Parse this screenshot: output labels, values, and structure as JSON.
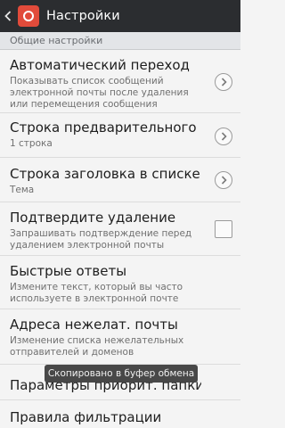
{
  "action_bar": {
    "title": "Настройки",
    "app_icon": "mail-app-icon",
    "back_icon": "chevron-left-icon"
  },
  "section": {
    "label": "Общие настройки"
  },
  "items": [
    {
      "title": "Автоматический переход",
      "summary": "Показывать список сообщений электронной почты после удаления или перемещения сообщения",
      "control": "chevron"
    },
    {
      "title": "Строка предварительного п...",
      "summary": "1 строка",
      "control": "chevron"
    },
    {
      "title": "Строка заголовка в списке",
      "summary": "Тема",
      "control": "chevron"
    },
    {
      "title": "Подтвердите удаление",
      "summary": "Запрашивать подтверждение перед удалением электронной почты",
      "control": "checkbox"
    },
    {
      "title": "Быстрые ответы",
      "summary": "Измените текст, который вы часто используете в электронной почте",
      "control": "none"
    },
    {
      "title": "Адреса нежелат. почты",
      "summary": "Изменение списка нежелательных отправителей и доменов",
      "control": "none"
    },
    {
      "title": "Параметры приорит. папки",
      "summary": "",
      "control": "none"
    },
    {
      "title": "Правила фильтрации",
      "summary": "",
      "control": "none"
    }
  ],
  "toast": {
    "text": "Скопировано в буфер обмена"
  },
  "colors": {
    "action_bar": "#2b2d30",
    "background": "#f4f4f4",
    "section_header": "#e3e5e8",
    "app_icon": "#e14b3b"
  }
}
